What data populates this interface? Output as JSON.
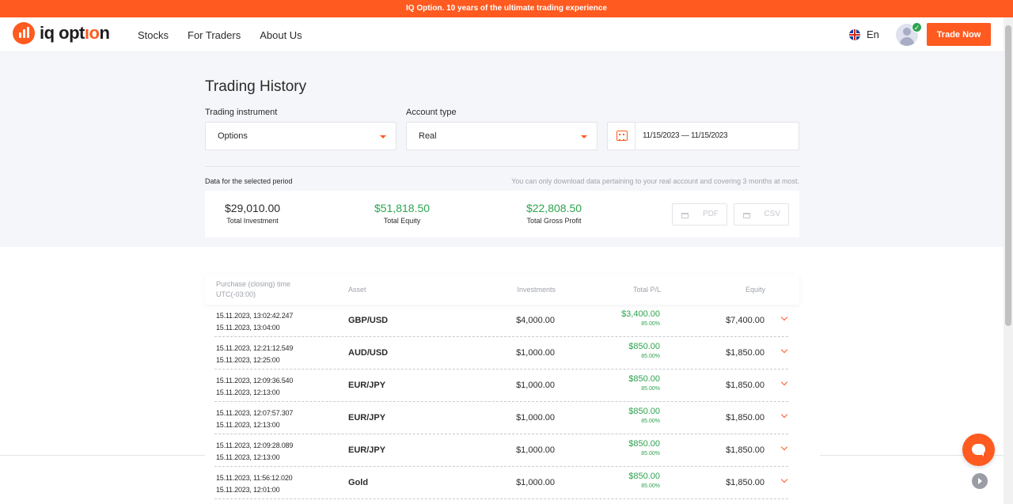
{
  "promo": {
    "text": "IQ Option. 10 years of the ultimate trading experience"
  },
  "header": {
    "logo_text_start": "iq opt",
    "logo_text_accent": "ıo",
    "logo_text_end": "n",
    "nav": [
      "Stocks",
      "For Traders",
      "About Us"
    ],
    "language": "En",
    "trade_button": "Trade Now"
  },
  "page": {
    "title": "Trading History",
    "instrument_label": "Trading instrument",
    "instrument_value": "Options",
    "account_label": "Account type",
    "account_value": "Real",
    "date_range": "11/15/2023 — 11/15/2023",
    "period_label": "Data for the selected period",
    "period_note": "You can only download data pertaining to your real account and covering 3 months at most."
  },
  "summary": {
    "total_investment": {
      "value": "$29,010.00",
      "label": "Total Investment"
    },
    "total_equity": {
      "value": "$51,818.50",
      "label": "Total Equity"
    },
    "total_gross_profit": {
      "value": "$22,808.50",
      "label": "Total Gross Profit"
    },
    "pdf_label": "PDF",
    "csv_label": "CSV"
  },
  "table": {
    "headers": {
      "time_line1": "Purchase (closing) time",
      "time_line2": "UTC(-03:00)",
      "asset": "Asset",
      "investments": "Investments",
      "total_pl": "Total P/L",
      "equity": "Equity"
    },
    "rows": [
      {
        "open": "15.11.2023, 13:02:42.247",
        "close": "15.11.2023, 13:04:00",
        "asset": "GBP/USD",
        "investment": "$4,000.00",
        "pl": "$3,400.00",
        "pl_pct": "85.00%",
        "equity": "$7,400.00"
      },
      {
        "open": "15.11.2023, 12:21:12.549",
        "close": "15.11.2023, 12:25:00",
        "asset": "AUD/USD",
        "investment": "$1,000.00",
        "pl": "$850.00",
        "pl_pct": "85.00%",
        "equity": "$1,850.00"
      },
      {
        "open": "15.11.2023, 12:09:36.540",
        "close": "15.11.2023, 12:13:00",
        "asset": "EUR/JPY",
        "investment": "$1,000.00",
        "pl": "$850.00",
        "pl_pct": "85.00%",
        "equity": "$1,850.00"
      },
      {
        "open": "15.11.2023, 12:07:57.307",
        "close": "15.11.2023, 12:13:00",
        "asset": "EUR/JPY",
        "investment": "$1,000.00",
        "pl": "$850.00",
        "pl_pct": "85.00%",
        "equity": "$1,850.00"
      },
      {
        "open": "15.11.2023, 12:09:28.089",
        "close": "15.11.2023, 12:13:00",
        "asset": "EUR/JPY",
        "investment": "$1,000.00",
        "pl": "$850.00",
        "pl_pct": "85.00%",
        "equity": "$1,850.00"
      },
      {
        "open": "15.11.2023, 11:56:12.020",
        "close": "15.11.2023, 12:01:00",
        "asset": "Gold",
        "investment": "$1,000.00",
        "pl": "$850.00",
        "pl_pct": "85.00%",
        "equity": "$1,850.00"
      }
    ]
  },
  "colors": {
    "accent": "#ff5a1f",
    "profit": "#2ea44f",
    "background": "#f5f6f9"
  },
  "icons": [
    "logo-icon",
    "uk-flag-icon",
    "avatar-icon",
    "verified-check-icon",
    "calendar-icon",
    "caret-down-icon",
    "document-icon",
    "chevron-down-icon",
    "chat-icon",
    "play-icon"
  ]
}
